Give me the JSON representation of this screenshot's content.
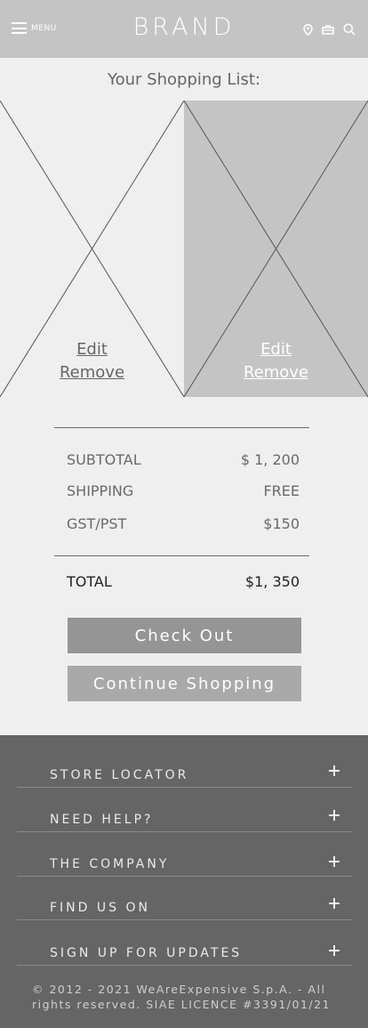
{
  "header": {
    "menu_label": "MENU",
    "brand": "BRAND",
    "icons": [
      "location-icon",
      "bag-icon",
      "search-icon"
    ]
  },
  "list_title": "Your Shopping List:",
  "products": [
    {
      "edit_label": "Edit",
      "remove_label": "Remove"
    },
    {
      "edit_label": "Edit",
      "remove_label": "Remove"
    }
  ],
  "summary": {
    "subtotal_label": "SUBTOTAL",
    "subtotal_value": "$ 1, 200",
    "shipping_label": "SHIPPING",
    "shipping_value": "FREE",
    "tax_label": "GST/PST",
    "tax_value": "$150",
    "total_label": "TOTAL",
    "total_value": "$1, 350"
  },
  "buttons": {
    "checkout": "Check Out",
    "continue": "Continue Shopping"
  },
  "footer": {
    "items": [
      {
        "label": "STORE LOCATOR"
      },
      {
        "label": "NEED HELP?"
      },
      {
        "label": "THE COMPANY"
      },
      {
        "label": "FIND US ON"
      },
      {
        "label": "SIGN UP FOR UPDATES"
      }
    ],
    "copyright_line1": "© 2012 - 2021 WeAreExpensive S.p.A. - All",
    "copyright_line2": "rights reserved. SIAE LICENCE #3391/01/21"
  },
  "colors": {
    "header_bg": "#c4c4c4",
    "page_bg": "#efefef",
    "footer_bg": "#656565",
    "checkout_bg": "#959595",
    "continue_bg": "#a9a9a9"
  }
}
